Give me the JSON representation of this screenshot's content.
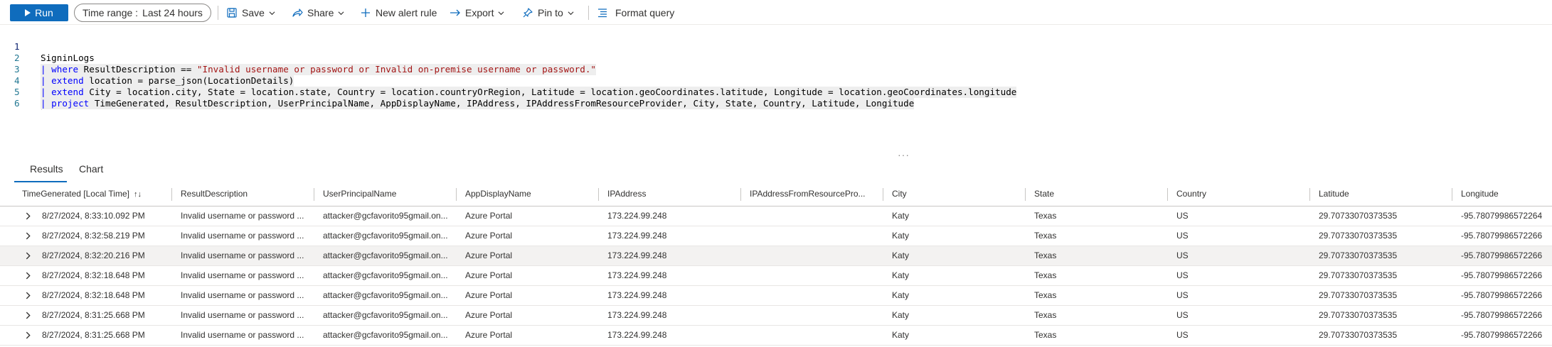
{
  "toolbar": {
    "run_label": "Run",
    "time_range_label": "Time range :",
    "time_range_value": "Last 24 hours",
    "save_label": "Save",
    "share_label": "Share",
    "new_alert_label": "New alert rule",
    "export_label": "Export",
    "pin_label": "Pin to",
    "format_label": "Format query"
  },
  "editor": {
    "lines": [
      {
        "num": "1",
        "text": "SigninLogs"
      },
      {
        "num": "2",
        "pipe": "| ",
        "kw": "where",
        "rest": " ResultDescription == ",
        "str": "\"Invalid username or password or Invalid on-premise username or password.\""
      },
      {
        "num": "3",
        "pipe": "| ",
        "kw": "extend",
        "rest": " location = parse_json(LocationDetails)"
      },
      {
        "num": "4",
        "pipe": "| ",
        "kw": "extend",
        "rest": " City = location.city, State = location.state, Country = location.countryOrRegion, Latitude = location.geoCoordinates.latitude, Longitude = location.geoCoordinates.longitude"
      },
      {
        "num": "5",
        "pipe": "| ",
        "kw": "project",
        "rest": " TimeGenerated, ResultDescription, UserPrincipalName, AppDisplayName, IPAddress, IPAddressFromResourceProvider, City, State, Country, Latitude, Longitude"
      },
      {
        "num": "6",
        "text": ""
      }
    ]
  },
  "results": {
    "tabs": [
      "Results",
      "Chart"
    ],
    "columns": [
      "TimeGenerated [Local Time]",
      "ResultDescription",
      "UserPrincipalName",
      "AppDisplayName",
      "IPAddress",
      "IPAddressFromResourcePro...",
      "City",
      "State",
      "Country",
      "Latitude",
      "Longitude"
    ],
    "rows": [
      [
        "8/27/2024, 8:33:10.092 PM",
        "Invalid username or password ...",
        "attacker@gcfavorito95gmail.on...",
        "Azure Portal",
        "173.224.99.248",
        "",
        "Katy",
        "Texas",
        "US",
        "29.70733070373535",
        "-95.78079986572264"
      ],
      [
        "8/27/2024, 8:32:58.219 PM",
        "Invalid username or password ...",
        "attacker@gcfavorito95gmail.on...",
        "Azure Portal",
        "173.224.99.248",
        "",
        "Katy",
        "Texas",
        "US",
        "29.70733070373535",
        "-95.78079986572266"
      ],
      [
        "8/27/2024, 8:32:20.216 PM",
        "Invalid username or password ...",
        "attacker@gcfavorito95gmail.on...",
        "Azure Portal",
        "173.224.99.248",
        "",
        "Katy",
        "Texas",
        "US",
        "29.70733070373535",
        "-95.78079986572266"
      ],
      [
        "8/27/2024, 8:32:18.648 PM",
        "Invalid username or password ...",
        "attacker@gcfavorito95gmail.on...",
        "Azure Portal",
        "173.224.99.248",
        "",
        "Katy",
        "Texas",
        "US",
        "29.70733070373535",
        "-95.78079986572266"
      ],
      [
        "8/27/2024, 8:32:18.648 PM",
        "Invalid username or password ...",
        "attacker@gcfavorito95gmail.on...",
        "Azure Portal",
        "173.224.99.248",
        "",
        "Katy",
        "Texas",
        "US",
        "29.70733070373535",
        "-95.78079986572266"
      ],
      [
        "8/27/2024, 8:31:25.668 PM",
        "Invalid username or password ...",
        "attacker@gcfavorito95gmail.on...",
        "Azure Portal",
        "173.224.99.248",
        "",
        "Katy",
        "Texas",
        "US",
        "29.70733070373535",
        "-95.78079986572266"
      ],
      [
        "8/27/2024, 8:31:25.668 PM",
        "Invalid username or password ...",
        "attacker@gcfavorito95gmail.on...",
        "Azure Portal",
        "173.224.99.248",
        "",
        "Katy",
        "Texas",
        "US",
        "29.70733070373535",
        "-95.78079986572266"
      ]
    ]
  },
  "colors": {
    "accent": "#0f6cbd",
    "keyword": "#0000ff",
    "string": "#a31515",
    "line_number": "#237893"
  },
  "icons": {
    "run": "play-icon",
    "save": "save-icon",
    "share": "share-icon",
    "new_alert": "plus-icon",
    "export": "export-arrow-icon",
    "pin": "pin-icon",
    "format": "format-lines-icon",
    "expand": "chevron-right-icon",
    "sort": "sort-arrows-icon"
  }
}
